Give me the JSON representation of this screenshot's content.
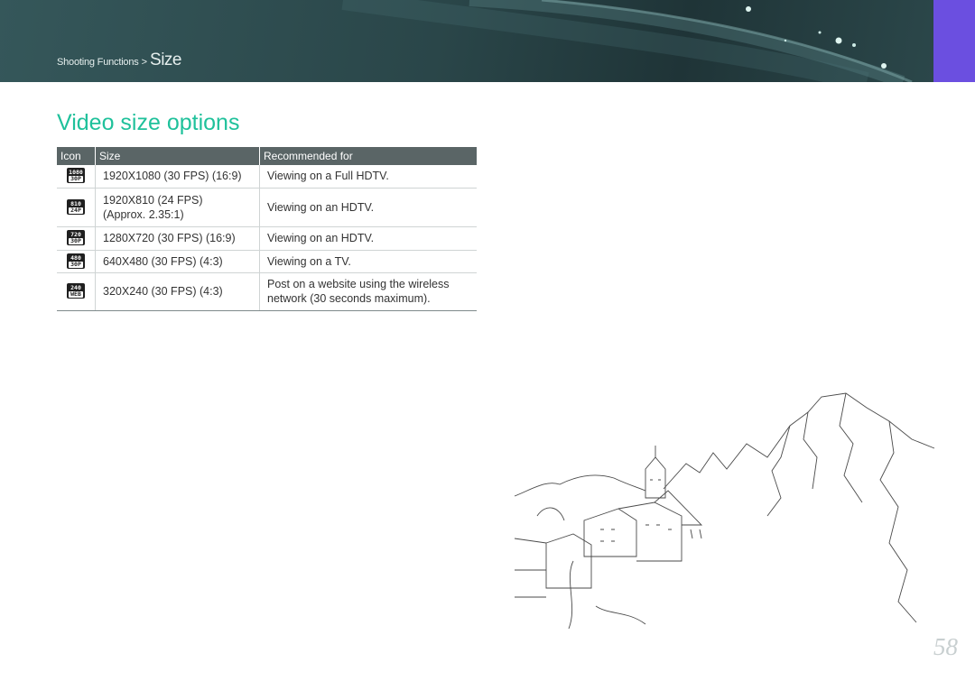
{
  "header": {
    "breadcrumb_parent": "Shooting Functions",
    "breadcrumb_separator": ">",
    "breadcrumb_current": "Size",
    "accent_color": "#6b4fe0"
  },
  "section": {
    "title": "Video size options",
    "title_color": "#1fc19b"
  },
  "table": {
    "headers": [
      "Icon",
      "Size",
      "Recommended for"
    ],
    "rows": [
      {
        "icon": "1080-30p-icon",
        "icon_top": "1080",
        "icon_bottom": "30P",
        "size": "1920X1080 (30 FPS) (16:9)",
        "size_line2": "",
        "recommended": "Viewing on a Full HDTV.",
        "recommended_line2": ""
      },
      {
        "icon": "810-24p-icon",
        "icon_top": "810",
        "icon_bottom": "24P",
        "size": "1920X810 (24 FPS)",
        "size_line2": "(Approx. 2.35:1)",
        "recommended": "Viewing on an HDTV.",
        "recommended_line2": ""
      },
      {
        "icon": "720-30p-icon",
        "icon_top": "720",
        "icon_bottom": "30P",
        "size": "1280X720 (30 FPS) (16:9)",
        "size_line2": "",
        "recommended": "Viewing on an HDTV.",
        "recommended_line2": ""
      },
      {
        "icon": "480-30p-icon",
        "icon_top": "480",
        "icon_bottom": "30P",
        "size": "640X480 (30 FPS) (4:3)",
        "size_line2": "",
        "recommended": "Viewing on a TV.",
        "recommended_line2": ""
      },
      {
        "icon": "240-web-icon",
        "icon_top": "240",
        "icon_bottom": "WEB",
        "size": "320X240 (30 FPS) (4:3)",
        "size_line2": "",
        "recommended": "Post on a website using the wireless",
        "recommended_line2": "network (30 seconds maximum)."
      }
    ]
  },
  "illustration": "village-mountain-sketch",
  "page_number": "58"
}
